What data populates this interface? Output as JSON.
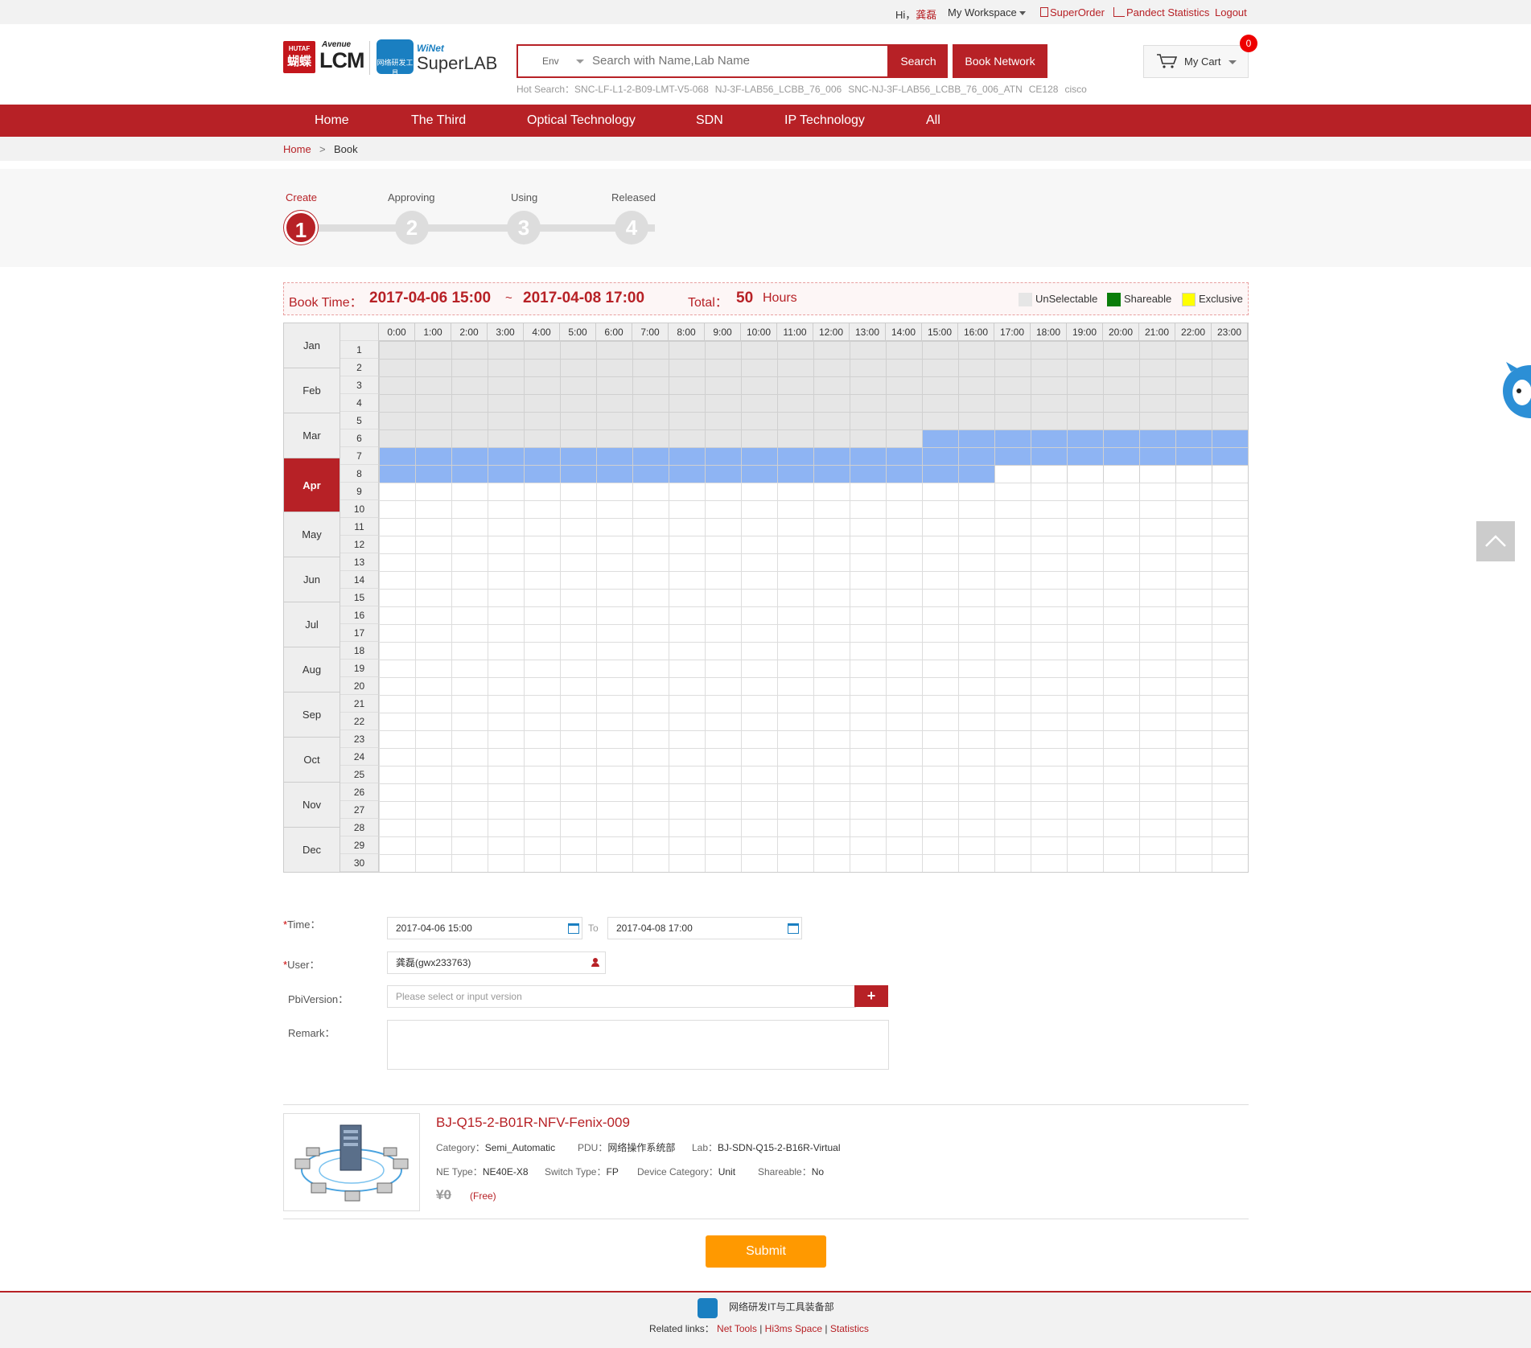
{
  "topbar": {
    "greeting": "Hi，",
    "username": "龚磊",
    "workspace": "My Workspace",
    "superorder": "SuperOrder",
    "pandect": "Pandect Statistics",
    "logout": "Logout"
  },
  "header": {
    "logo_hutaf_line1": "HUTAF",
    "logo_hutaf_line2": "蝴蝶",
    "logo_avenue": "Avenue",
    "logo_lcm": "LCM",
    "logo_winet_small": "网络研发工具",
    "logo_winet": "WiNet",
    "logo_superlab": "SuperLAB",
    "env_label": "Env",
    "search_placeholder": "Search with Name,Lab Name",
    "search_button": "Search",
    "book_network": "Book Network",
    "hot_search_label": "Hot Search：",
    "hot_search": [
      "SNC-LF-L1-2-B09-LMT-V5-068",
      "NJ-3F-LAB56_LCBB_76_006",
      "SNC-NJ-3F-LAB56_LCBB_76_006_ATN",
      "CE128",
      "cisco"
    ],
    "cart_label": "My Cart",
    "cart_count": "0"
  },
  "nav": [
    "Home",
    "The Third",
    "Optical Technology",
    "SDN",
    "IP Technology",
    "All"
  ],
  "breadcrumb": {
    "home": "Home",
    "sep": ">",
    "current": "Book"
  },
  "steps": [
    {
      "label": "Create",
      "num": "1",
      "active": true
    },
    {
      "label": "Approving",
      "num": "2",
      "active": false
    },
    {
      "label": "Using",
      "num": "3",
      "active": false
    },
    {
      "label": "Released",
      "num": "4",
      "active": false
    }
  ],
  "booktime": {
    "label": "Book Time：",
    "start": "2017-04-06 15:00",
    "tilde": "~",
    "end": "2017-04-08 17:00",
    "total_label": "Total：",
    "total_value": "50",
    "total_unit": "Hours",
    "legend": [
      {
        "label": "UnSelectable",
        "color": "#e6e6e6"
      },
      {
        "label": "Shareable",
        "color": "#0a7d0a"
      },
      {
        "label": "Exclusive",
        "color": "#ffff00"
      }
    ]
  },
  "calendar": {
    "months": [
      "Jan",
      "Feb",
      "Mar",
      "Apr",
      "May",
      "Jun",
      "Jul",
      "Aug",
      "Sep",
      "Oct",
      "Nov",
      "Dec"
    ],
    "active_month": "Apr",
    "hours": [
      "0:00",
      "1:00",
      "2:00",
      "3:00",
      "4:00",
      "5:00",
      "6:00",
      "7:00",
      "8:00",
      "9:00",
      "10:00",
      "11:00",
      "12:00",
      "13:00",
      "14:00",
      "15:00",
      "16:00",
      "17:00",
      "18:00",
      "19:00",
      "20:00",
      "21:00",
      "22:00",
      "23:00"
    ],
    "days": [
      "1",
      "2",
      "3",
      "4",
      "5",
      "6",
      "7",
      "8",
      "9",
      "10",
      "11",
      "12",
      "13",
      "14",
      "15",
      "16",
      "17",
      "18",
      "19",
      "20",
      "21",
      "22",
      "23",
      "24",
      "25",
      "26",
      "27",
      "28",
      "29",
      "30"
    ],
    "unselectable_color": "#e6e6e6",
    "selected_color": "#8eb4f3"
  },
  "form": {
    "time_label": "Time：",
    "time_start": "2017-04-06 15:00",
    "time_to": "To",
    "time_end": "2017-04-08 17:00",
    "user_label": "User：",
    "user_value": "龚磊(gwx233763)",
    "pbi_label": "PbiVersion：",
    "pbi_placeholder": "Please select or input version",
    "pbi_add": "+",
    "remark_label": "Remark："
  },
  "product": {
    "title": "BJ-Q15-2-B01R-NFV-Fenix-009",
    "category_label": "Category：",
    "category": "Semi_Automatic",
    "pdu_label": "PDU：",
    "pdu": "网络操作系统部",
    "lab_label": "Lab：",
    "lab": "BJ-SDN-Q15-2-B16R-Virtual",
    "netype_label": "NE Type：",
    "netype": "NE40E-X8",
    "switch_label": "Switch Type：",
    "switch": "FP",
    "devcat_label": "Device Category：",
    "devcat": "Unit",
    "shareable_label": "Shareable：",
    "shareable": "No",
    "price": "¥0",
    "free": "(Free)"
  },
  "submit": "Submit",
  "footer": {
    "org": "网络研发IT与工具装备部",
    "related": "Related links：",
    "links": [
      "Net Tools",
      "Hi3ms Space",
      "Statistics"
    ],
    "sep": "|"
  }
}
